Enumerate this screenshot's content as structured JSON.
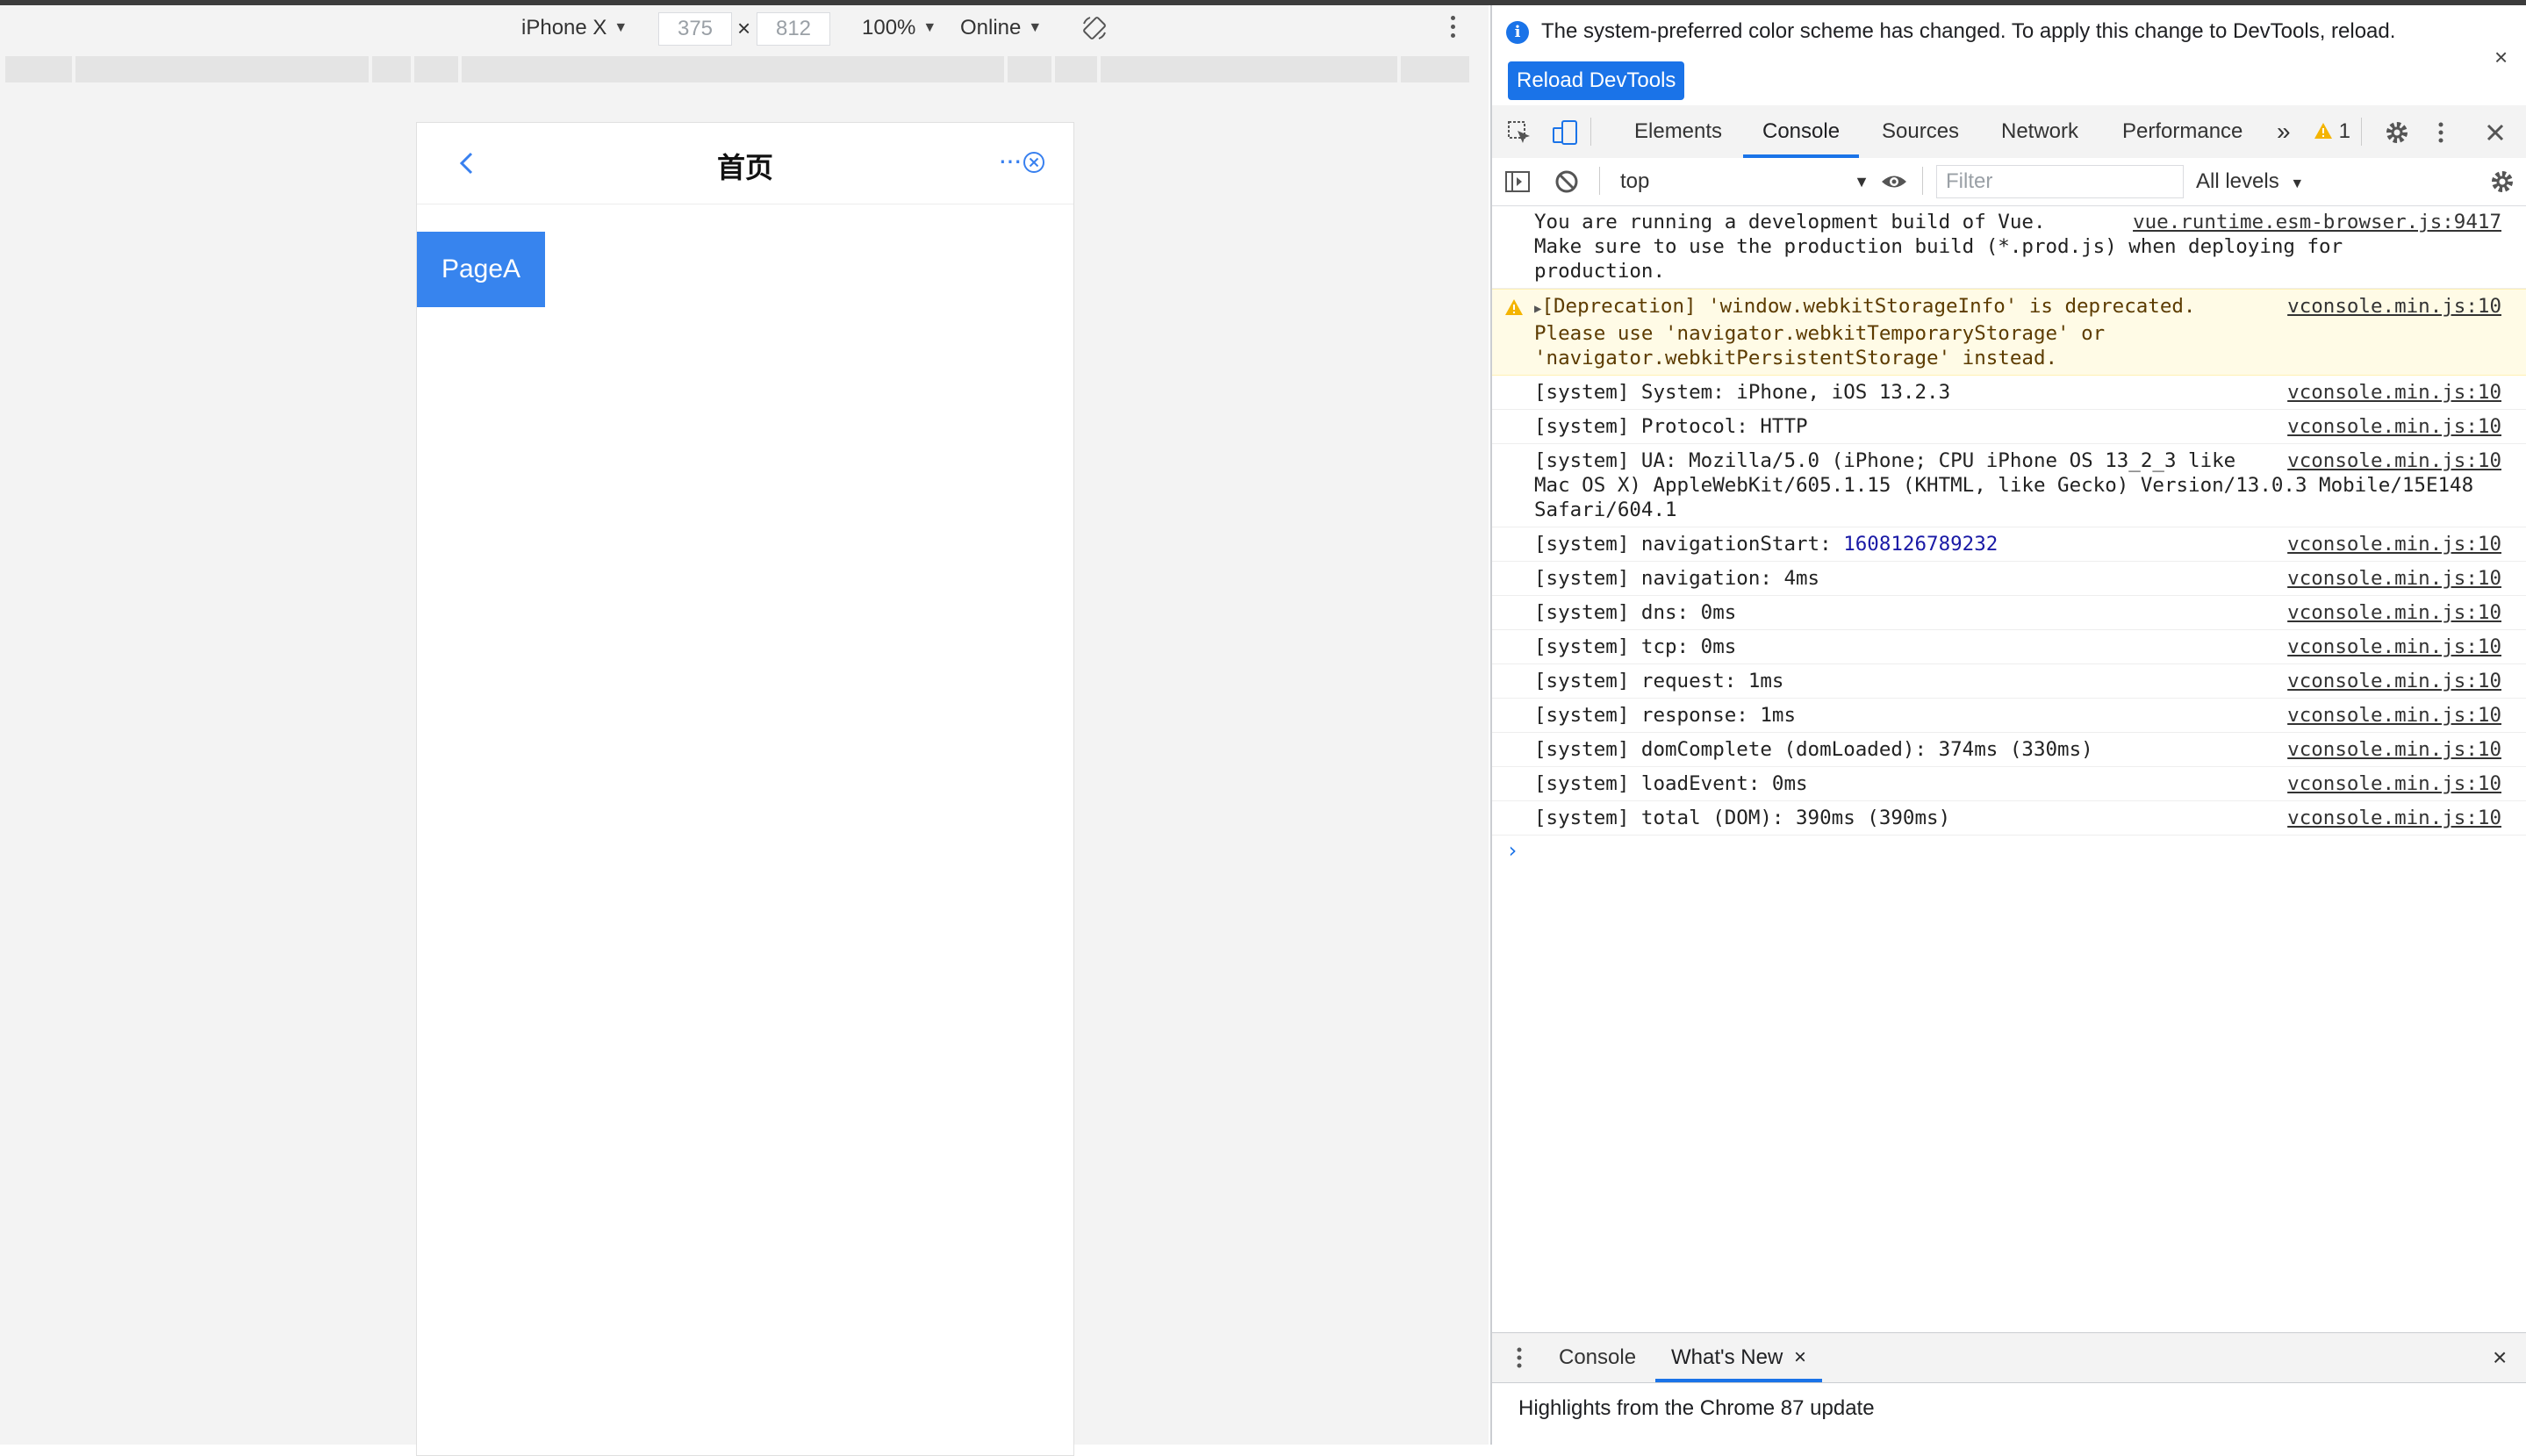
{
  "device_toolbar": {
    "device": "iPhone X",
    "width": "375",
    "times": "×",
    "height": "812",
    "zoom": "100%",
    "throttle": "Online"
  },
  "mobile": {
    "title": "首页",
    "more": "···",
    "button": "PageA",
    "accent": "#3784ee"
  },
  "infobar": {
    "message": "The system-preferred color scheme has changed. To apply this change to DevTools, reload.",
    "reload": "Reload DevTools",
    "close": "×"
  },
  "tabs": {
    "elements": "Elements",
    "console": "Console",
    "sources": "Sources",
    "network": "Network",
    "performance": "Performance",
    "overflow": "»",
    "warn_count": "1"
  },
  "console_bar": {
    "context": "top",
    "filter_placeholder": "Filter",
    "levels": "All levels"
  },
  "messages": [
    {
      "text": "You are running a development build of Vue.\nMake sure to use the production build (*.prod.js) when deploying for production.",
      "source": "vue.runtime.esm-browser.js:9417"
    },
    {
      "text": "[Deprecation] 'window.webkitStorageInfo' is deprecated. Please use 'navigator.webkitTemporaryStorage' or 'navigator.webkitPersistentStorage' instead.",
      "source": "vconsole.min.js:10"
    },
    {
      "text": "[system] System: iPhone, iOS 13.2.3",
      "source": "vconsole.min.js:10"
    },
    {
      "text": "[system] Protocol: HTTP",
      "source": "vconsole.min.js:10"
    },
    {
      "text": "[system] UA: Mozilla/5.0 (iPhone; CPU iPhone OS 13_2_3 like Mac OS X) AppleWebKit/605.1.15 (KHTML, like Gecko) Version/13.0.3 Mobile/15E148 Safari/604.1",
      "source": "vconsole.min.js:10"
    },
    {
      "text": "[system] navigationStart: ",
      "number": "1608126789232",
      "source": "vconsole.min.js:10"
    },
    {
      "text": "[system] navigation: 4ms",
      "source": "vconsole.min.js:10"
    },
    {
      "text": "[system] dns: 0ms",
      "source": "vconsole.min.js:10"
    },
    {
      "text": "[system] tcp: 0ms",
      "source": "vconsole.min.js:10"
    },
    {
      "text": "[system] request: 1ms",
      "source": "vconsole.min.js:10"
    },
    {
      "text": "[system] response: 1ms",
      "source": "vconsole.min.js:10"
    },
    {
      "text": "[system] domComplete (domLoaded): 374ms (330ms)",
      "source": "vconsole.min.js:10"
    },
    {
      "text": "[system] loadEvent: 0ms",
      "source": "vconsole.min.js:10"
    },
    {
      "text": "[system] total (DOM): 390ms (390ms)",
      "source": "vconsole.min.js:10"
    }
  ],
  "prompt": "›",
  "drawer": {
    "tab_console": "Console",
    "tab_whats_new": "What's New",
    "tab_close": "×",
    "close": "×",
    "highlight": "Highlights from the Chrome 87 update"
  },
  "colors": {
    "accent": "#1a73e8",
    "warning_bg": "#fffbe6"
  }
}
